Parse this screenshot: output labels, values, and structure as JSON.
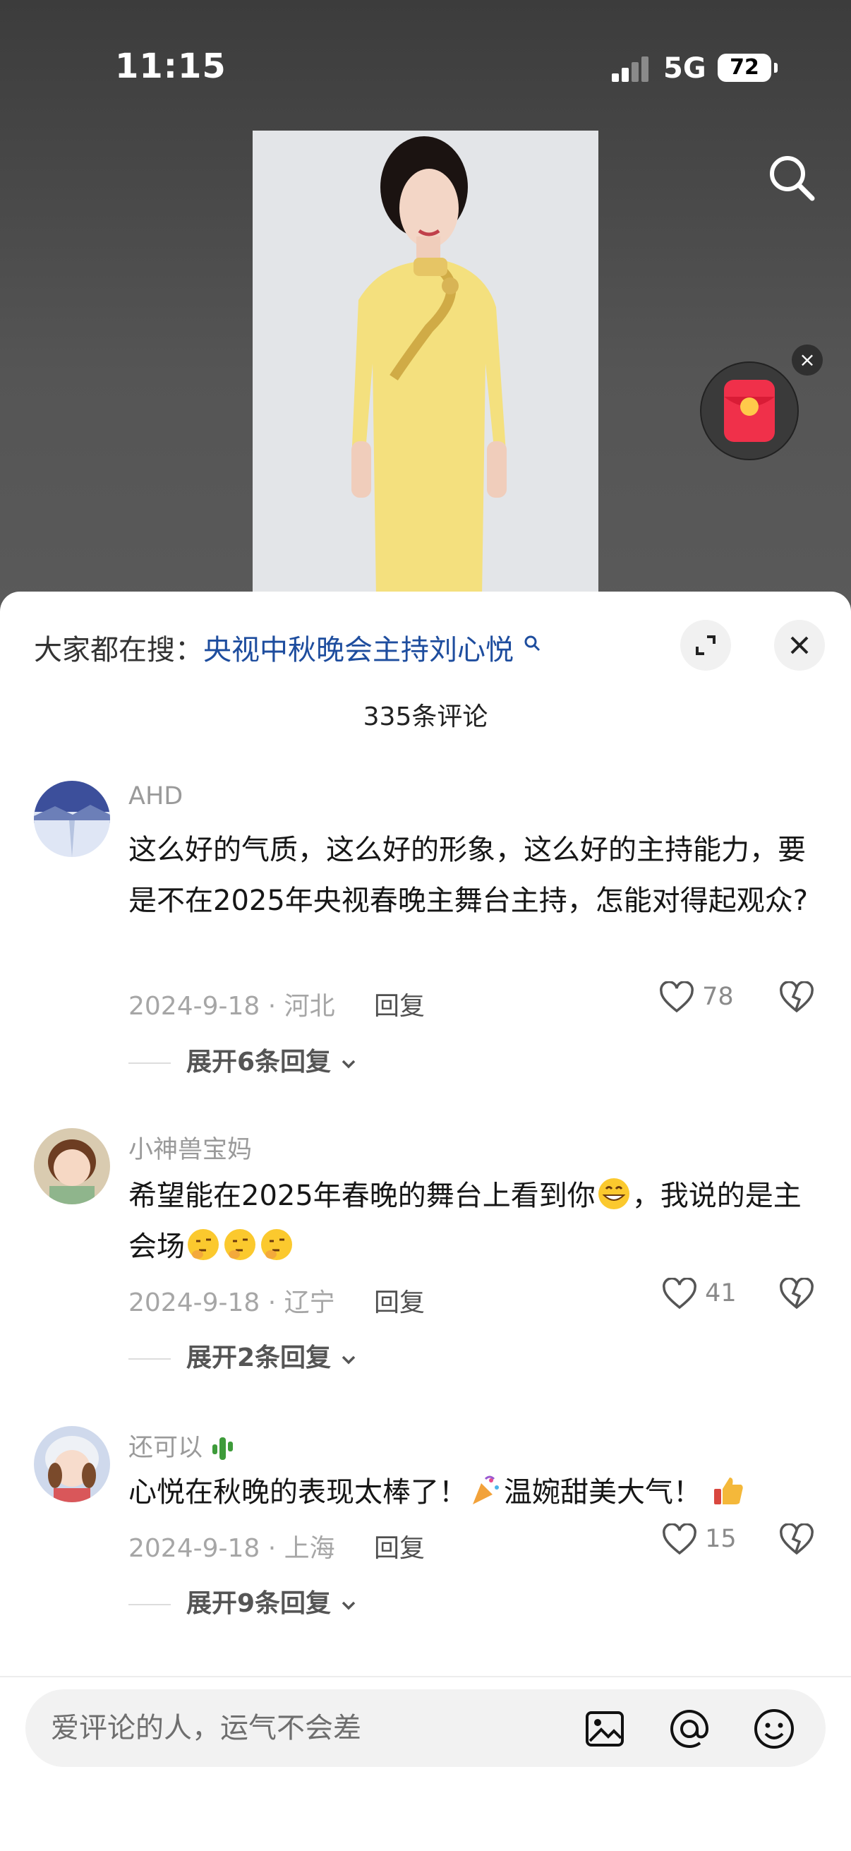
{
  "status_bar": {
    "time": "11:15",
    "network": "5G",
    "battery": "72"
  },
  "sheet": {
    "hot_search_prefix": "大家都在搜：",
    "hot_search_term": "央视中秋晚会主持刘心悦",
    "comment_count": "335条评论"
  },
  "comments": [
    {
      "username": "AHD",
      "text": "这么好的气质，这么好的形象，这么好的主持能力，要是不在2025年央视春晚主舞台主持，怎能对得起观众?",
      "meta": "2024-9-18 · 河北",
      "reply": "回复",
      "likes": "78",
      "expand": "展开6条回复"
    },
    {
      "username": "小神兽宝妈",
      "text_a": "希望能在2025年春晚的舞台上看到你",
      "text_b": "，我说的是主会场",
      "meta": "2024-9-18 · 辽宁",
      "reply": "回复",
      "likes": "41",
      "expand": "展开2条回复"
    },
    {
      "username": "还可以",
      "text_a": "心悦在秋晚的表现太棒了！",
      "text_b": "温婉甜美大气！",
      "meta": "2024-9-18 · 上海",
      "reply": "回复",
      "likes": "15",
      "expand": "展开9条回复"
    }
  ],
  "input": {
    "placeholder": "爱评论的人，运气不会差"
  },
  "icons": [
    "search-icon",
    "red-packet-icon",
    "close-icon",
    "expand-icon",
    "heart-icon",
    "broken-heart-icon",
    "image-icon",
    "at-icon",
    "emoji-icon",
    "cactus-icon",
    "party-popper-icon",
    "thumbs-up-icon",
    "grin-icon",
    "thinking-face-icon"
  ],
  "colors": {
    "accent_link": "#1e4d9e",
    "meta_gray": "#a6a6a6",
    "sheet_bg": "#ffffff"
  }
}
